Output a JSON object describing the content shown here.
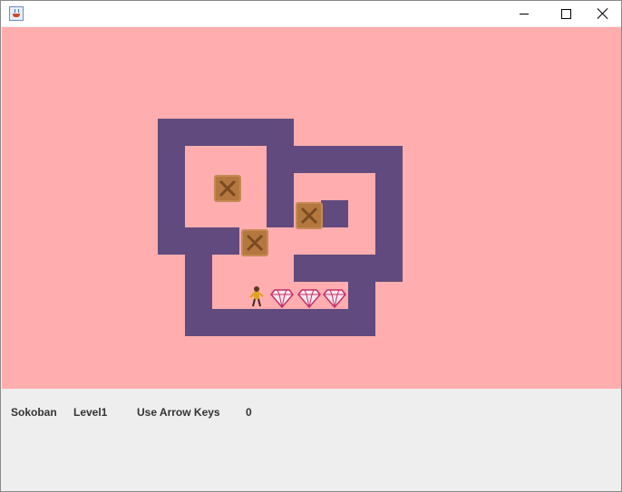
{
  "window": {
    "title": "",
    "controls": [
      "minimize",
      "maximize",
      "close"
    ]
  },
  "board": {
    "background_color": "#ffadae",
    "wall_color": "#604a7e",
    "crate_color": "#b4773f",
    "tile_count_crates": 3,
    "tile_count_goals": 3
  },
  "status": {
    "game_name": "Sokoban",
    "level": "Level1",
    "hint": "Use Arrow Keys",
    "moves": "0"
  }
}
